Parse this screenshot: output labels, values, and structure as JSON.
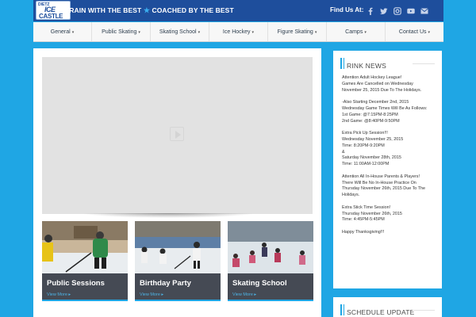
{
  "header": {
    "logo": {
      "line1": "DIETZ",
      "line2": "ICE",
      "line3": "CASTLE"
    },
    "tagline_left": "TRAIN WITH THE BEST",
    "tagline_right": "COACHED BY THE BEST",
    "find_us": "Find Us At:",
    "social_icons": [
      "facebook-icon",
      "twitter-icon",
      "instagram-icon",
      "youtube-icon",
      "email-icon"
    ]
  },
  "nav": {
    "items": [
      {
        "label": "General"
      },
      {
        "label": "Public Skating"
      },
      {
        "label": "Skating School"
      },
      {
        "label": "Ice Hockey"
      },
      {
        "label": "Figure Skating"
      },
      {
        "label": "Camps"
      },
      {
        "label": "Contact Us"
      }
    ]
  },
  "cards": [
    {
      "title": "Public Sessions",
      "more": "View More"
    },
    {
      "title": "Birthday Party",
      "more": "View More"
    },
    {
      "title": "Skating School",
      "more": "View More"
    }
  ],
  "sidebar": {
    "rink_news_title": "RINK NEWS",
    "news_lines": [
      "Attention Adult Hockey League!",
      "Games Are Cancelled on Wednesday",
      "November 25, 2015 Due To The Holidays.",
      "",
      "-Also Starting December 2nd, 2015",
      "Wednesday Game Times Will Be As Follows:",
      "1st Game: @7:15PM-8:25PM",
      "2nd Game: @8:40PM-9:50PM",
      "",
      "Extra Pick Up Session!!!",
      "Wednesday November 25, 2015",
      "Time: 8:20PM-9:20PM",
      "&",
      "Saturday November 28th, 2015",
      "Time: 11:00AM-12:00PM",
      "",
      "Attention All In-House Parents & Players!",
      "There Will Be No In-House Practice On",
      "Thursday November 26th, 2015 Due To The",
      "Holidays.",
      "",
      "Extra Stick Time Session!",
      "Thursday November 26th, 2015",
      "Time: 4:45PM-5:45PM",
      "",
      "Happy Thanksgiving!!!"
    ],
    "schedule_title": "SCHEDULE UPDATE"
  },
  "colors": {
    "background": "#1fa6e4",
    "header": "#1e4e9c",
    "card": "#454a54",
    "accent": "#1fa6e4"
  }
}
